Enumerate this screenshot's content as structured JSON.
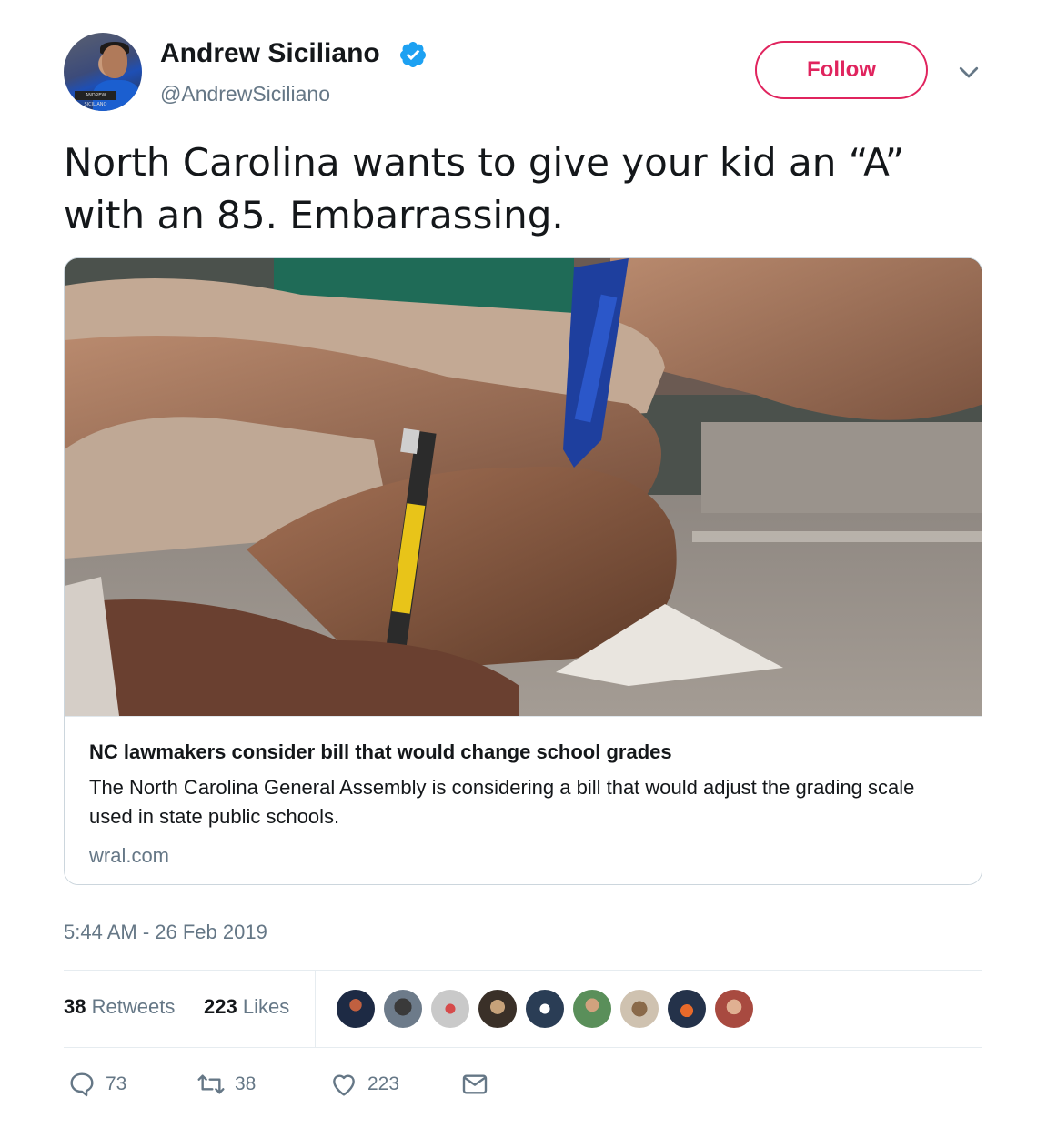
{
  "author": {
    "name": "Andrew Siciliano",
    "handle": "@AndrewSiciliano",
    "verified": true,
    "avatar_caption": "ANDREW SICILIANO"
  },
  "follow_label": "Follow",
  "tweet": {
    "text": "North Carolina wants to give your kid an “A” with an 85. Embarrassing."
  },
  "card": {
    "title": "NC lawmakers consider bill that would change school grades",
    "description": "The North Carolina General Assembly is considering a bill that would adjust the grading scale used in state public schools.",
    "domain": "wral.com"
  },
  "timestamp": "5:44 AM - 26 Feb 2019",
  "stats": {
    "retweets_count": "38",
    "retweets_label": "Retweets",
    "likes_count": "223",
    "likes_label": "Likes"
  },
  "actions": {
    "replies": "73",
    "retweets": "38",
    "likes": "223"
  },
  "colors": {
    "follow_accent": "#e0245e",
    "verified_blue": "#1da1f2",
    "secondary_text": "#657786",
    "primary_text": "#14171a",
    "border": "#ccd6dd"
  },
  "icons": [
    "verified-icon",
    "chevron-down-icon",
    "reply-icon",
    "retweet-icon",
    "like-icon",
    "message-icon"
  ]
}
